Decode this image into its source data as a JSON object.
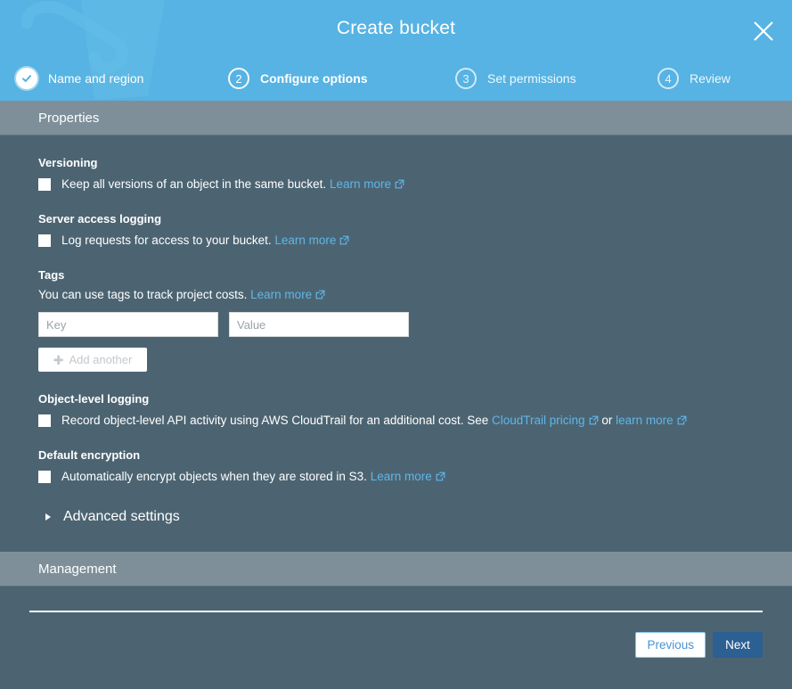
{
  "header": {
    "title": "Create bucket",
    "close_icon": "close-icon",
    "bucket_icon": "bucket-illustration",
    "steps": [
      {
        "number": "1",
        "label": "Name and region",
        "state": "completed"
      },
      {
        "number": "2",
        "label": "Configure options",
        "state": "active"
      },
      {
        "number": "3",
        "label": "Set permissions",
        "state": "upcoming"
      },
      {
        "number": "4",
        "label": "Review",
        "state": "upcoming"
      }
    ]
  },
  "sections": {
    "properties_title": "Properties",
    "management_title": "Management"
  },
  "properties": {
    "versioning": {
      "title": "Versioning",
      "checkbox_checked": false,
      "text": "Keep all versions of an object in the same bucket.",
      "link": "Learn more"
    },
    "server_access_logging": {
      "title": "Server access logging",
      "checkbox_checked": false,
      "text": "Log requests for access to your bucket.",
      "link": "Learn more"
    },
    "tags": {
      "title": "Tags",
      "description": "You can use tags to track project costs.",
      "link": "Learn more",
      "key_value": "",
      "key_placeholder": "Key",
      "value_value": "",
      "value_placeholder": "Value",
      "add_another_label": "Add another",
      "add_another_icon": "plus-icon",
      "add_another_disabled": true
    },
    "object_level_logging": {
      "title": "Object-level logging",
      "checkbox_checked": false,
      "text_before": "Record object-level API activity using AWS CloudTrail for an additional cost. See",
      "link_pricing": "CloudTrail pricing",
      "text_between": "or",
      "link_learn": "learn more"
    },
    "default_encryption": {
      "title": "Default encryption",
      "checkbox_checked": false,
      "text": "Automatically encrypt objects when they are stored in S3.",
      "link": "Learn more"
    },
    "advanced_settings": {
      "label": "Advanced settings",
      "expanded": false,
      "icon": "chevron-right-icon"
    }
  },
  "footer": {
    "previous_label": "Previous",
    "next_label": "Next"
  },
  "colors": {
    "header_blue": "#56b3e3",
    "body_slate": "#4c6472",
    "band_grey": "#7e8f99",
    "link_blue": "#5fb6e8",
    "next_button_blue": "#2c5f92",
    "previous_text_blue": "#4b93d1"
  }
}
